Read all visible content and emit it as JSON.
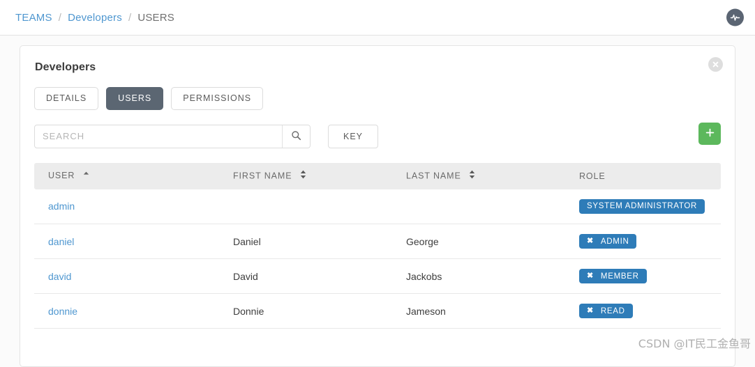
{
  "breadcrumb": {
    "separator": "/",
    "items": [
      {
        "label": "TEAMS",
        "type": "link"
      },
      {
        "label": "Developers",
        "type": "link"
      },
      {
        "label": "USERS",
        "type": "current"
      }
    ]
  },
  "header": {
    "activity_icon": "pulse-icon"
  },
  "card": {
    "title": "Developers",
    "close_icon": "close-circle-icon",
    "tabs": [
      {
        "label": "DETAILS",
        "active": false
      },
      {
        "label": "USERS",
        "active": true
      },
      {
        "label": "PERMISSIONS",
        "active": false
      }
    ]
  },
  "toolbar": {
    "search_value": "",
    "search_placeholder": "SEARCH",
    "search_icon": "magnifier-icon",
    "key_label": "KEY",
    "add_icon": "plus-icon",
    "add_color": "#5cb85c"
  },
  "table": {
    "columns": [
      {
        "label": "USER",
        "sort": "asc"
      },
      {
        "label": "FIRST NAME",
        "sort": "both"
      },
      {
        "label": "LAST NAME",
        "sort": "both"
      },
      {
        "label": "ROLE",
        "sort": "none"
      }
    ],
    "rows": [
      {
        "user": "admin",
        "first_name": "",
        "last_name": "",
        "role": {
          "label": "SYSTEM ADMINISTRATOR",
          "removable": false
        }
      },
      {
        "user": "daniel",
        "first_name": "Daniel",
        "last_name": "George",
        "role": {
          "label": "ADMIN",
          "removable": true
        }
      },
      {
        "user": "david",
        "first_name": "David",
        "last_name": "Jackobs",
        "role": {
          "label": "MEMBER",
          "removable": true
        }
      },
      {
        "user": "donnie",
        "first_name": "Donnie",
        "last_name": "Jameson",
        "role": {
          "label": "READ",
          "removable": true
        }
      }
    ],
    "badge_remove_glyph": "✖",
    "badge_color": "#2e7cb8"
  },
  "watermark": {
    "text": "CSDN @IT民工金鱼哥"
  }
}
